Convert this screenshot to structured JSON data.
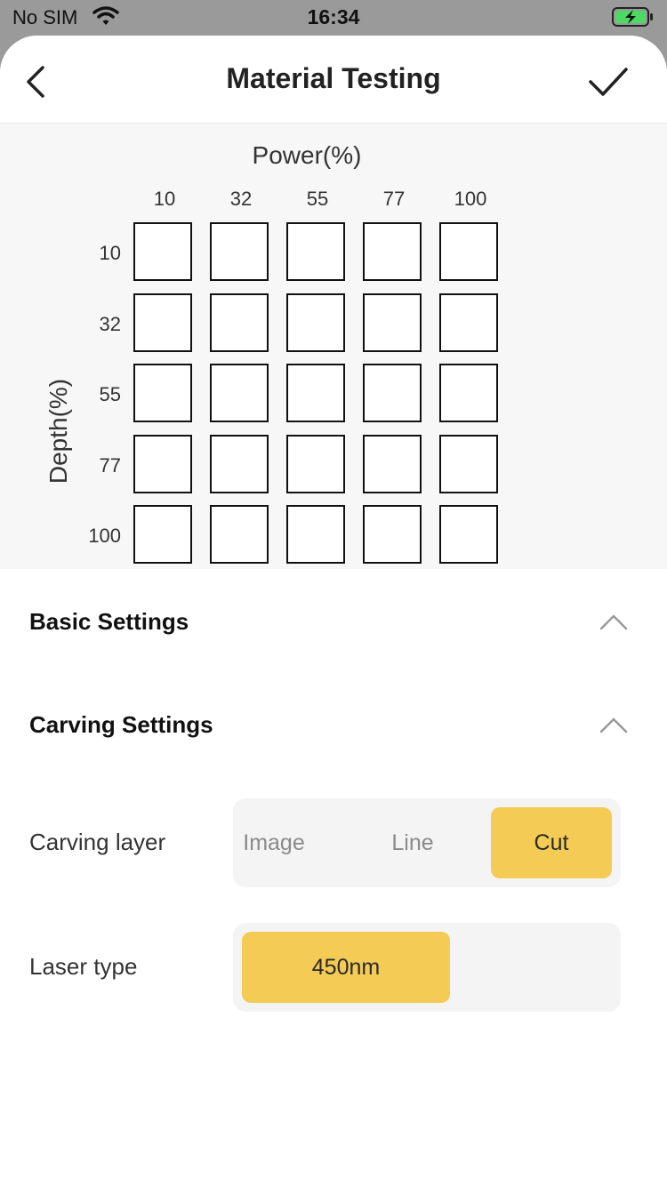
{
  "status_bar": {
    "carrier": "No SIM",
    "time": "16:34"
  },
  "header": {
    "title": "Material Testing",
    "back_icon": "chevron-left-icon",
    "confirm_icon": "check-icon"
  },
  "grid": {
    "x_label": "Power(%)",
    "y_label": "Depth(%)",
    "power_values": [
      "10",
      "32",
      "55",
      "77",
      "100"
    ],
    "depth_values": [
      "10",
      "32",
      "55",
      "77",
      "100"
    ]
  },
  "sections": {
    "basic": {
      "title": "Basic Settings",
      "expanded": true
    },
    "carving": {
      "title": "Carving Settings",
      "expanded": true
    }
  },
  "carving_layer": {
    "label": "Carving layer",
    "options": [
      "Image",
      "Line",
      "Cut"
    ],
    "selected": "Cut"
  },
  "laser_type": {
    "label": "Laser type",
    "options": [
      "450nm"
    ],
    "selected": "450nm"
  },
  "colors": {
    "accent": "#f4cb55",
    "panel_bg": "#f7f7f7",
    "segment_bg": "#f4f4f4",
    "battery": "#4cd964"
  }
}
